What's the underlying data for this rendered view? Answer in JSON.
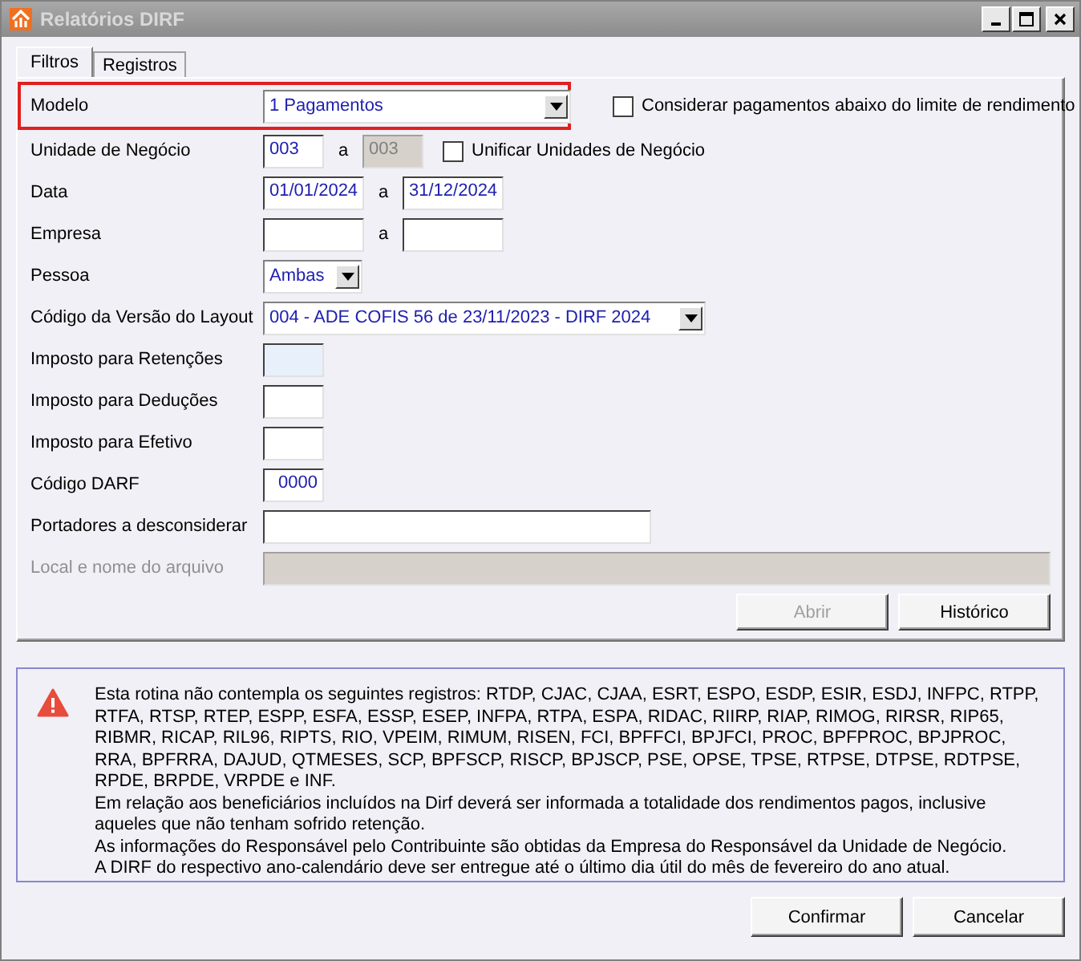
{
  "window": {
    "title": "Relatórios DIRF"
  },
  "tabs": [
    {
      "label": "Filtros",
      "selected": true
    },
    {
      "label": "Registros",
      "selected": false
    }
  ],
  "rows": [
    {
      "label": "Modelo",
      "disabled": false,
      "highlighted": true,
      "fields": [
        {
          "kind": "combo",
          "value": "1 Pagamentos"
        }
      ],
      "checkbox": {
        "label": "Considerar pagamentos abaixo do limite de rendimento",
        "checked": false
      }
    },
    {
      "label": "Unidade de Negócio",
      "disabled": false,
      "highlighted": false,
      "separator": "a",
      "fields": [
        {
          "kind": "text",
          "value": "003"
        },
        {
          "kind": "locked",
          "value": "003"
        }
      ],
      "checkbox": {
        "label": "Unificar Unidades de Negócio",
        "checked": false
      }
    },
    {
      "label": "Data",
      "disabled": false,
      "highlighted": false,
      "separator": "a",
      "fields": [
        {
          "kind": "text",
          "value": "01/01/2024"
        },
        {
          "kind": "text",
          "value": "31/12/2024"
        }
      ]
    },
    {
      "label": "Empresa",
      "disabled": false,
      "highlighted": false,
      "separator": "a",
      "fields": [
        {
          "kind": "text"
        },
        {
          "kind": "text"
        }
      ]
    },
    {
      "label": "Pessoa",
      "disabled": false,
      "highlighted": false,
      "fields": [
        {
          "kind": "combo",
          "value": "Ambas"
        }
      ]
    },
    {
      "label": "Código da Versão do Layout",
      "disabled": false,
      "highlighted": false,
      "fields": [
        {
          "kind": "combo",
          "value": "004 - ADE COFIS 56 de 23/11/2023 - DIRF 2024"
        }
      ]
    },
    {
      "label": "Imposto para Retenções",
      "disabled": false,
      "highlighted": false,
      "fields": [
        {
          "kind": "current"
        }
      ]
    },
    {
      "label": "Imposto para Deduções",
      "disabled": false,
      "highlighted": false,
      "fields": [
        {
          "kind": "text"
        }
      ]
    },
    {
      "label": "Imposto para Efetivo",
      "disabled": false,
      "highlighted": false,
      "fields": [
        {
          "kind": "text"
        }
      ]
    },
    {
      "label": "Código DARF",
      "disabled": false,
      "highlighted": false,
      "fields": [
        {
          "kind": "number",
          "value": "0000"
        }
      ]
    },
    {
      "label": "Portadores a desconsiderar",
      "disabled": false,
      "highlighted": false,
      "fields": [
        {
          "kind": "text"
        }
      ]
    },
    {
      "label": "Local e nome do arquivo",
      "disabled": true,
      "highlighted": false,
      "fields": [
        {
          "kind": "locked"
        }
      ]
    }
  ],
  "panel_buttons": [
    {
      "label": "Abrir",
      "disabled": true
    },
    {
      "label": "Histórico",
      "disabled": false
    }
  ],
  "message": [
    "Esta rotina não contempla os seguintes registros: RTDP, CJAC, CJAA, ESRT, ESPO, ESDP, ESIR, ESDJ, INFPC, RTPP, RTFA, RTSP, RTEP, ESPP, ESFA, ESSP, ESEP, INFPA, RTPA, ESPA, RIDAC, RIIRP, RIAP, RIMOG, RIRSR, RIP65, RIBMR, RICAP, RIL96, RIPTS, RIO, VPEIM, RIMUM, RISEN, FCI, BPFFCI, BPJFCI, PROC, BPFPROC, BPJPROC, RRA, BPFRRA, DAJUD, QTMESES, SCP, BPFSCP, RISCP, BPJSCP, PSE, OPSE, TPSE, RTPSE, DTPSE, RDTPSE, RPDE, BRPDE, VRPDE e INF.",
    "Em relação aos beneficiários incluídos na Dirf deverá ser informada a totalidade dos rendimentos pagos, inclusive aqueles que não tenham sofrido retenção.",
    "As informações do Responsável pelo Contribuinte são obtidas da Empresa do Responsável da Unidade de Negócio.",
    "A DIRF do respectivo ano-calendário deve ser entregue até o último dia útil do mês de fevereiro do ano atual."
  ],
  "buttons": [
    {
      "label": "Confirmar",
      "disabled": false
    },
    {
      "label": "Cancelar",
      "disabled": false
    }
  ]
}
